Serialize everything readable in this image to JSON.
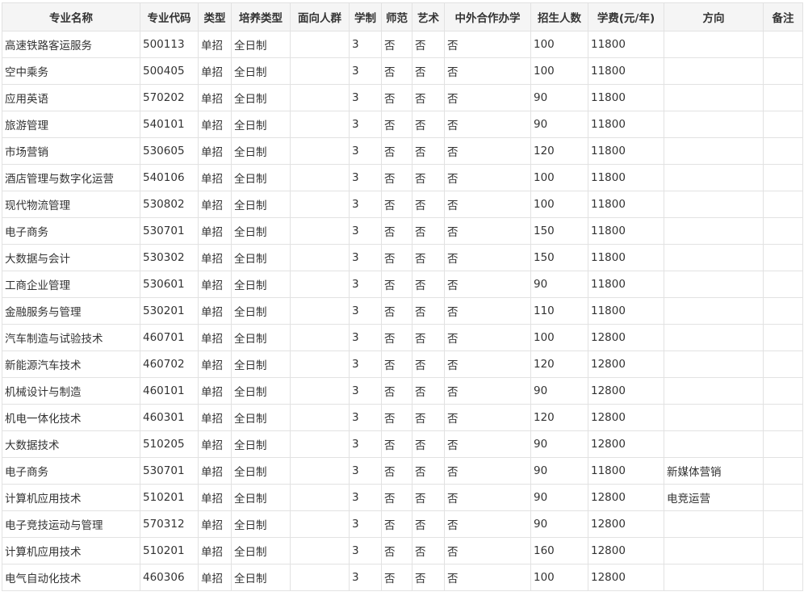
{
  "table": {
    "headers": [
      "专业名称",
      "专业代码",
      "类型",
      "培养类型",
      "面向人群",
      "学制",
      "师范",
      "艺术",
      "中外合作办学",
      "招生人数",
      "学费(元/年)",
      "方向",
      "备注"
    ],
    "rows": [
      [
        "高速铁路客运服务",
        "500113",
        "单招",
        "全日制",
        "",
        "3",
        "否",
        "否",
        "否",
        "100",
        "11800",
        "",
        ""
      ],
      [
        "空中乘务",
        "500405",
        "单招",
        "全日制",
        "",
        "3",
        "否",
        "否",
        "否",
        "100",
        "11800",
        "",
        ""
      ],
      [
        "应用英语",
        "570202",
        "单招",
        "全日制",
        "",
        "3",
        "否",
        "否",
        "否",
        "90",
        "11800",
        "",
        ""
      ],
      [
        "旅游管理",
        "540101",
        "单招",
        "全日制",
        "",
        "3",
        "否",
        "否",
        "否",
        "90",
        "11800",
        "",
        ""
      ],
      [
        "市场营销",
        "530605",
        "单招",
        "全日制",
        "",
        "3",
        "否",
        "否",
        "否",
        "120",
        "11800",
        "",
        ""
      ],
      [
        "酒店管理与数字化运营",
        "540106",
        "单招",
        "全日制",
        "",
        "3",
        "否",
        "否",
        "否",
        "100",
        "11800",
        "",
        ""
      ],
      [
        "现代物流管理",
        "530802",
        "单招",
        "全日制",
        "",
        "3",
        "否",
        "否",
        "否",
        "100",
        "11800",
        "",
        ""
      ],
      [
        "电子商务",
        "530701",
        "单招",
        "全日制",
        "",
        "3",
        "否",
        "否",
        "否",
        "150",
        "11800",
        "",
        ""
      ],
      [
        "大数据与会计",
        "530302",
        "单招",
        "全日制",
        "",
        "3",
        "否",
        "否",
        "否",
        "150",
        "11800",
        "",
        ""
      ],
      [
        "工商企业管理",
        "530601",
        "单招",
        "全日制",
        "",
        "3",
        "否",
        "否",
        "否",
        "90",
        "11800",
        "",
        ""
      ],
      [
        "金融服务与管理",
        "530201",
        "单招",
        "全日制",
        "",
        "3",
        "否",
        "否",
        "否",
        "110",
        "11800",
        "",
        ""
      ],
      [
        "汽车制造与试验技术",
        "460701",
        "单招",
        "全日制",
        "",
        "3",
        "否",
        "否",
        "否",
        "100",
        "12800",
        "",
        ""
      ],
      [
        "新能源汽车技术",
        "460702",
        "单招",
        "全日制",
        "",
        "3",
        "否",
        "否",
        "否",
        "120",
        "12800",
        "",
        ""
      ],
      [
        "机械设计与制造",
        "460101",
        "单招",
        "全日制",
        "",
        "3",
        "否",
        "否",
        "否",
        "90",
        "12800",
        "",
        ""
      ],
      [
        "机电一体化技术",
        "460301",
        "单招",
        "全日制",
        "",
        "3",
        "否",
        "否",
        "否",
        "120",
        "12800",
        "",
        ""
      ],
      [
        "大数据技术",
        "510205",
        "单招",
        "全日制",
        "",
        "3",
        "否",
        "否",
        "否",
        "90",
        "12800",
        "",
        ""
      ],
      [
        "电子商务",
        "530701",
        "单招",
        "全日制",
        "",
        "3",
        "否",
        "否",
        "否",
        "90",
        "11800",
        "新媒体营销",
        ""
      ],
      [
        "计算机应用技术",
        "510201",
        "单招",
        "全日制",
        "",
        "3",
        "否",
        "否",
        "否",
        "90",
        "12800",
        "电竞运营",
        ""
      ],
      [
        "电子竞技运动与管理",
        "570312",
        "单招",
        "全日制",
        "",
        "3",
        "否",
        "否",
        "否",
        "90",
        "12800",
        "",
        ""
      ],
      [
        "计算机应用技术",
        "510201",
        "单招",
        "全日制",
        "",
        "3",
        "否",
        "否",
        "否",
        "160",
        "12800",
        "",
        ""
      ],
      [
        "电气自动化技术",
        "460306",
        "单招",
        "全日制",
        "",
        "3",
        "否",
        "否",
        "否",
        "100",
        "12800",
        "",
        ""
      ]
    ]
  }
}
